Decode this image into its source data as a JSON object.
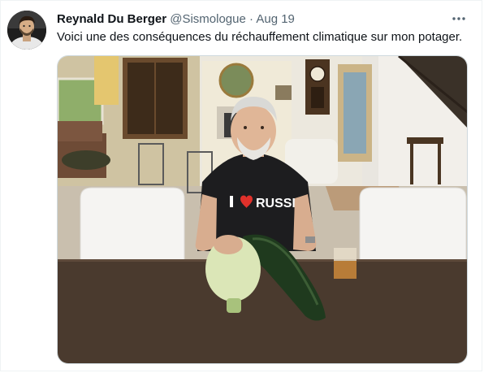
{
  "tweet": {
    "author": {
      "display_name": "Reynald Du Berger",
      "handle": "@Sismologue",
      "separator": "·",
      "date": "Aug 19"
    },
    "more_icon": "more-horizontal-icon",
    "text": "Voici une des conséquences du réchauffement climatique sur mon potager.",
    "media": {
      "shirt_text": "RUSSIA",
      "shirt_symbol": "heart"
    }
  },
  "colors": {
    "text_primary": "#0f1419",
    "text_secondary": "#536471",
    "border": "#cfd9de",
    "shirt_heart": "#e0312b"
  }
}
